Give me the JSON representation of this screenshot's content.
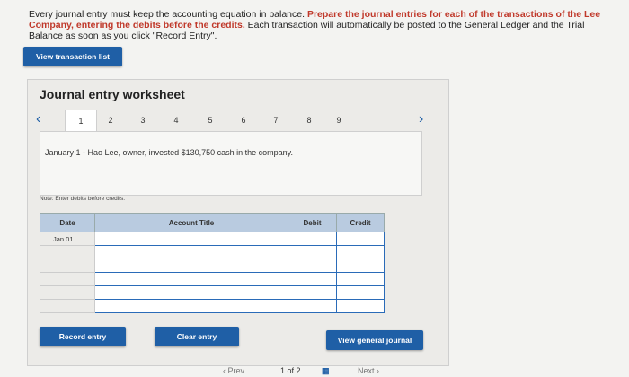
{
  "intro": {
    "part1": "Every journal entry must keep the accounting equation in balance. ",
    "bold1": "Prepare the journal entries for each of the transactions of the Lee Company, entering the debits before the credits.",
    "part2": " Each transaction will automatically be posted to the General Ledger and the Trial Balance as soon as you click \"Record Entry\"."
  },
  "view_transaction_label": "View transaction list",
  "worksheet": {
    "title": "Journal entry worksheet",
    "pages": [
      "1",
      "2",
      "3",
      "4",
      "5",
      "6",
      "7",
      "8",
      "9"
    ],
    "active_page": "1",
    "description": "January 1 - Hao Lee, owner, invested $130,750 cash in the company.",
    "note": "Note: Enter debits before credits.",
    "headers": {
      "date": "Date",
      "account": "Account Title",
      "debit": "Debit",
      "credit": "Credit"
    },
    "rows": [
      {
        "date": "Jan 01"
      },
      {
        "date": ""
      },
      {
        "date": ""
      },
      {
        "date": ""
      },
      {
        "date": ""
      },
      {
        "date": ""
      }
    ]
  },
  "buttons": {
    "record": "Record entry",
    "clear": "Clear entry",
    "view_general": "View general journal"
  },
  "bottom_nav": {
    "prev": "Prev",
    "page_info": "1 of 2",
    "next": "Next"
  },
  "colors": {
    "accent": "#1f5fa6",
    "header_bg": "#b9cbe0",
    "warning": "#c0392b"
  }
}
